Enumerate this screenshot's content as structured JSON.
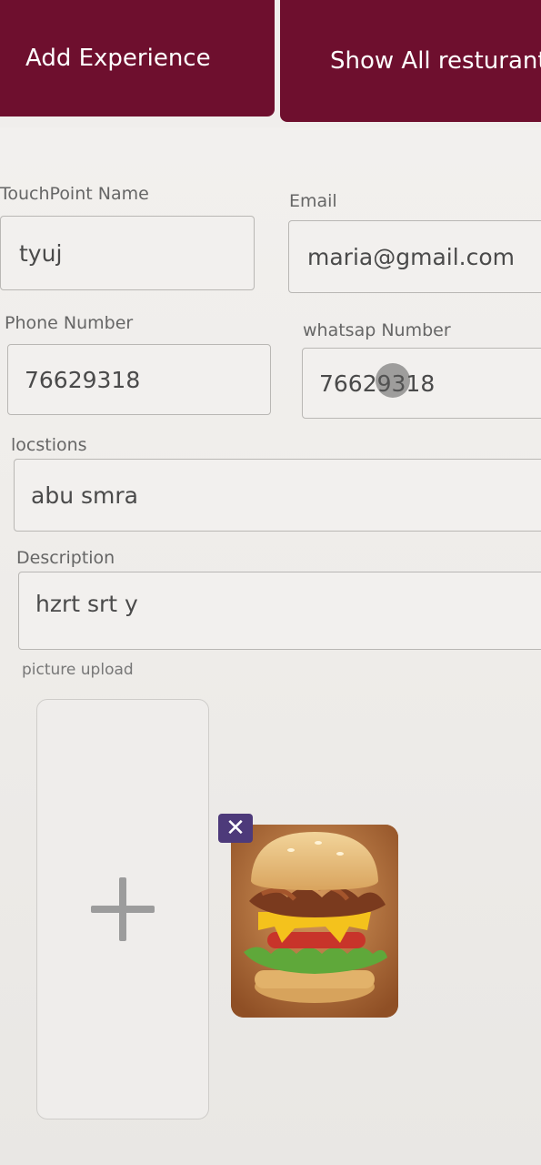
{
  "header": {
    "add_experience": "Add Experience",
    "show_all": "Show All resturant"
  },
  "form": {
    "touchpoint_name": {
      "label": "TouchPoint Name",
      "value": "tyuj"
    },
    "email": {
      "label": "Email",
      "value": "maria@gmail.com"
    },
    "phone_number": {
      "label": "Phone Number",
      "value": "76629318"
    },
    "whatsapp_number": {
      "label": "whatsap Number",
      "value": "76629318"
    },
    "location": {
      "label": "locstions",
      "value": "abu smra"
    },
    "description": {
      "label": "Description",
      "value": "hzrt srt y"
    },
    "picture_upload": {
      "label": "picture upload"
    }
  },
  "icons": {
    "add": "plus-icon",
    "remove": "close-icon"
  },
  "colors": {
    "header_bg": "#6e0f2e",
    "remove_badge": "#4d3a7a"
  }
}
